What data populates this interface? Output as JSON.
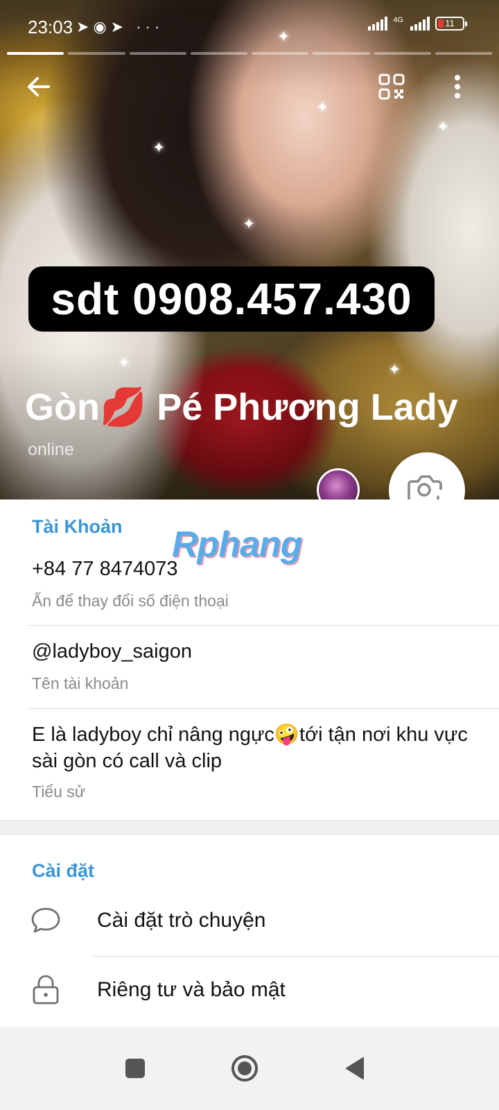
{
  "status_bar": {
    "time": "23:03",
    "app_icons": [
      "telegram-icon",
      "messenger-icon",
      "telegram-icon"
    ],
    "overflow": "···",
    "network_label": "4G",
    "battery_level": "11"
  },
  "header": {
    "story_segments": 8,
    "phone_overlay": "sdt 0908.457.430",
    "name": "Gòn💋    Pé Phương Lady",
    "status": "online",
    "icons": {
      "back": "arrow-left-icon",
      "qr": "qr-code-icon",
      "more": "more-vertical-icon",
      "camera": "camera-add-icon"
    }
  },
  "account": {
    "title": "Tài Khoản",
    "watermark": "Rphang",
    "phone": "+84 77 8474073",
    "phone_hint": "Ấn để thay đổi số điện thoại",
    "username": "@ladyboy_saigon",
    "username_hint": "Tên tài khoản",
    "bio": "E là ladyboy chỉ nâng ngực🤪tới tận nơi khu vực sài gòn có call và clip",
    "bio_hint": "Tiểu sử"
  },
  "settings": {
    "title": "Cài đặt",
    "items": [
      {
        "label": "Cài đặt trò chuyện",
        "icon": "chat-bubble-icon"
      },
      {
        "label": "Riêng tư và bảo mật",
        "icon": "lock-icon"
      }
    ]
  },
  "nav_bar": {
    "buttons": [
      "recents-square-icon",
      "home-circle-icon",
      "back-triangle-icon"
    ]
  },
  "colors": {
    "accent": "#3a95d5",
    "text_primary": "#111111",
    "text_secondary": "#8a8a8a",
    "overlay_bg": "#000000"
  }
}
